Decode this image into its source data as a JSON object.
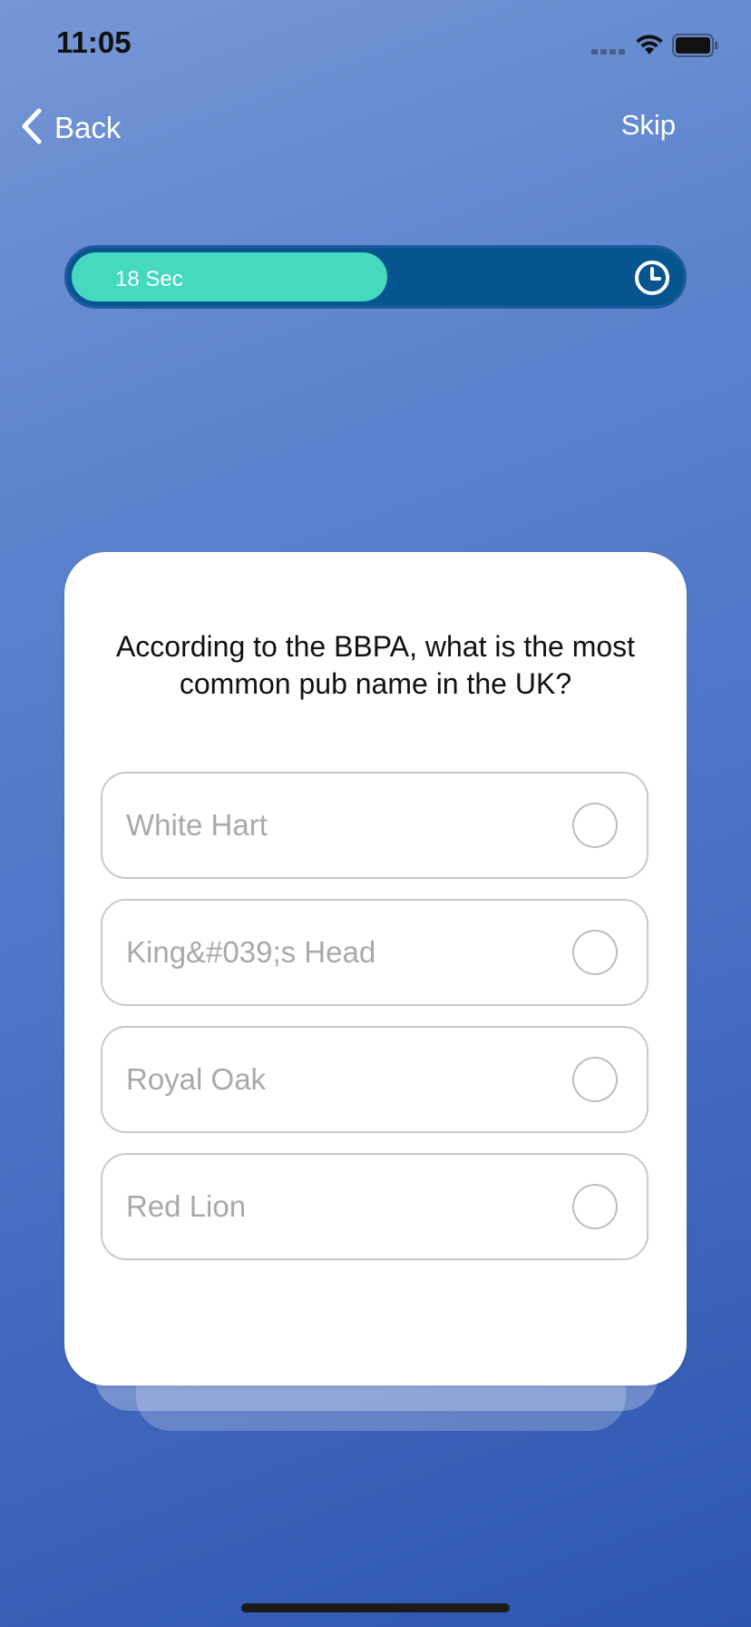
{
  "status_bar": {
    "time": "11:05"
  },
  "nav": {
    "back_label": "Back",
    "skip_label": "Skip"
  },
  "timer": {
    "label": "18 Sec",
    "remaining_fraction": 0.52,
    "fill_color": "#45d9bf",
    "track_color": "#06558f"
  },
  "question": {
    "text": "According to the BBPA, what is the most common pub name in the UK?",
    "options": [
      {
        "label": "White Hart",
        "selected": false
      },
      {
        "label": "King&#039;s Head",
        "selected": false
      },
      {
        "label": "Royal Oak",
        "selected": false
      },
      {
        "label": "Red Lion",
        "selected": false
      }
    ]
  },
  "icons": {
    "back": "chevron-left-icon",
    "timer": "clock-icon",
    "wifi": "wifi-icon",
    "battery": "battery-icon",
    "signal": "cellular-signal-icon"
  }
}
